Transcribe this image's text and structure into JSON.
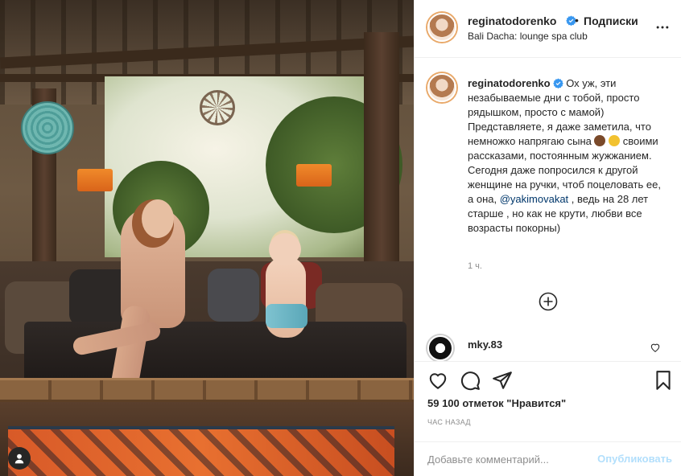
{
  "post": {
    "username": "reginatodorenko",
    "follow_separator": "•",
    "follow_label": "Подписки",
    "location": "Bali Dacha: lounge spa club",
    "caption_line1": "Ох уж, эти незабываемые дни с тобой, просто рядышком, просто с мамой)",
    "caption_line2": "Представляете, я даже заметила, что немножко напрягаю сына",
    "caption_line3": "своими рассказами, постоянным жужжанием. Сегодня даже попросился к другой женщине на ручки, чтоб поцеловать ее, а она,",
    "caption_mention": "@yakimovakat",
    "caption_line4": ", ведь на 28 лет старше , но как не крути, любви все возрасты покорны)",
    "time_ago": "1 ч.",
    "likes": "59 100 отметок \"Нравится\"",
    "posted": "ЧАС НАЗАД"
  },
  "comments": [
    {
      "username": "mky.83"
    }
  ],
  "add_comment": {
    "placeholder": "Добавьте комментарий...",
    "publish_label": "Опубликовать"
  },
  "icons": {
    "verified": "verified-badge-icon",
    "more": "more-options-icon",
    "load_more": "plus-circle-icon",
    "like": "heart-icon",
    "comment": "comment-bubble-icon",
    "share": "paper-plane-icon",
    "save": "bookmark-icon",
    "user_tag": "user-tag-icon"
  },
  "colors": {
    "verified": "#3897f0",
    "mention": "#00376b",
    "publish_disabled": "#b2dffc",
    "muted": "#8e8e8e"
  }
}
